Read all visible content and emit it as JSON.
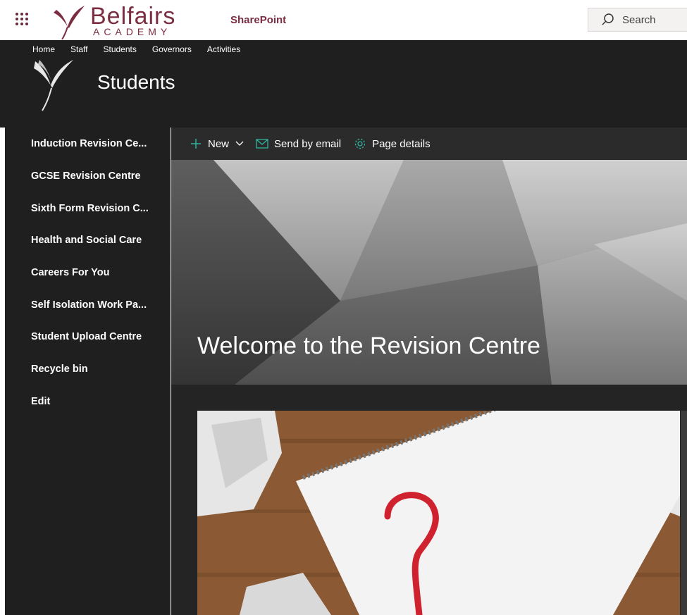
{
  "suite": {
    "logo_word": "Belfairs",
    "logo_sub": "ACADEMY",
    "brand": "SharePoint",
    "search_placeholder": "Search"
  },
  "site": {
    "title": "Students",
    "topnav": [
      "Home",
      "Staff",
      "Students",
      "Governors",
      "Activities"
    ]
  },
  "leftnav": {
    "items": [
      "Induction Revision Ce...",
      "GCSE Revision Centre",
      "Sixth Form Revision C...",
      "Health and Social Care",
      "Careers For You",
      "Self Isolation Work Pa...",
      "Student Upload Centre",
      "Recycle bin",
      "Edit"
    ]
  },
  "commandbar": {
    "new_label": "New",
    "email_label": "Send by email",
    "details_label": "Page details"
  },
  "hero": {
    "title": "Welcome to the Revision Centre"
  },
  "colors": {
    "brand": "#7b2d42",
    "header_bg": "#1f1f1f",
    "command_bg": "#2b2b2b",
    "accent": "#2fb3a0"
  }
}
